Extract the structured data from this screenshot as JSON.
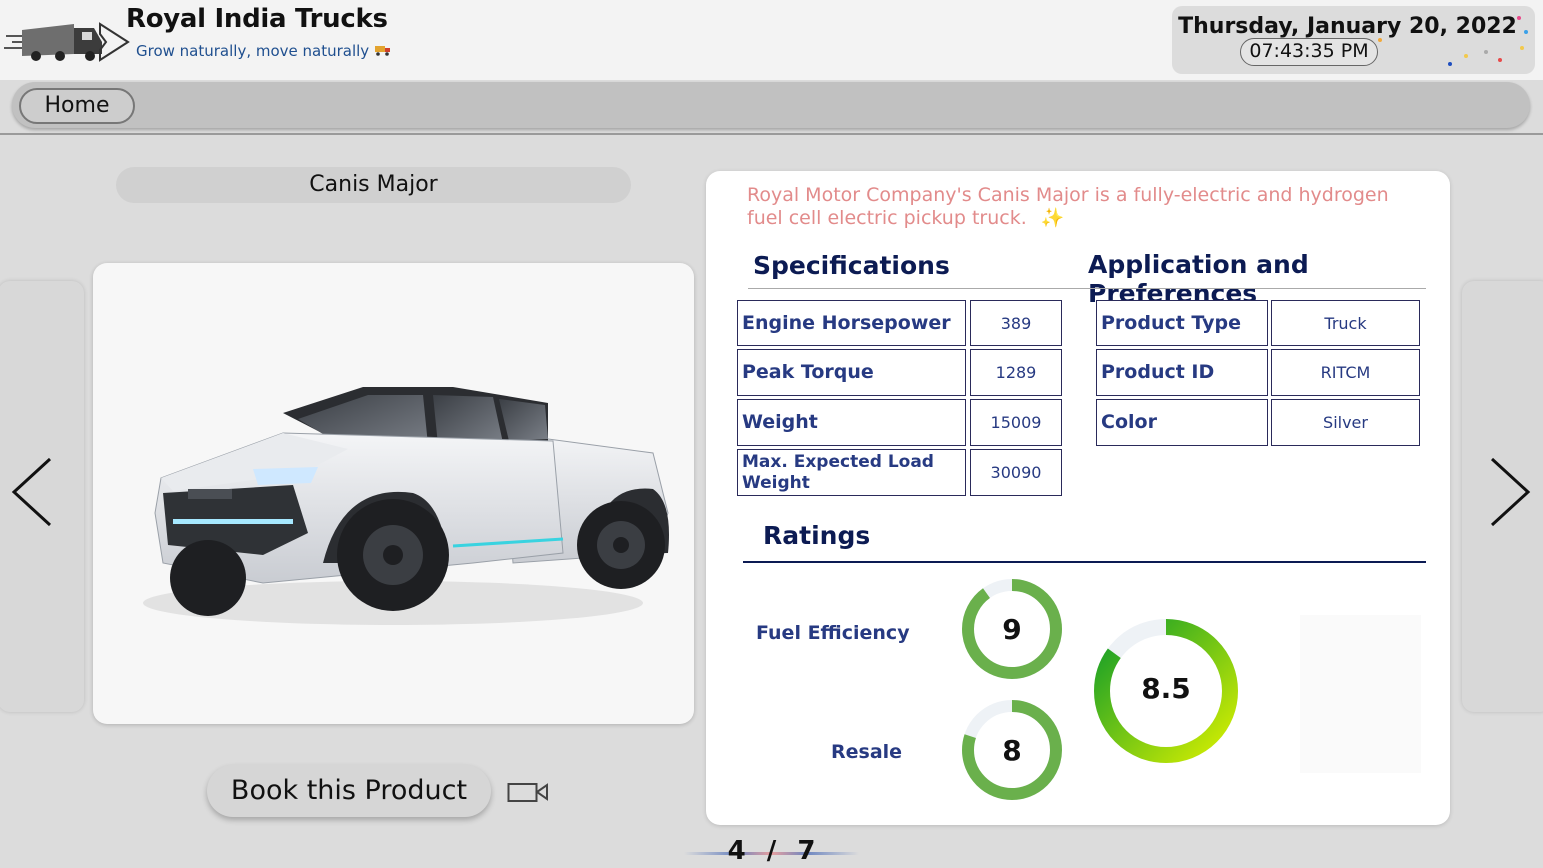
{
  "header": {
    "title": "Royal India Trucks",
    "tagline": "Grow naturally, move naturally",
    "tagline_icon": "truck-emoji",
    "date": "Thursday, January 20, 2022",
    "time": "07:43:35 PM"
  },
  "nav": {
    "home_label": "Home"
  },
  "product": {
    "name": "Canis Major",
    "description": "Royal Motor Company's Canis Major is a fully-electric and hydrogen fuel cell electric pickup truck.",
    "description_icon": "sparkles",
    "book_label": "Book this Product",
    "video_icon": "video-camera-icon"
  },
  "specifications": {
    "heading": "Specifications",
    "rows": [
      {
        "label": "Engine Horsepower",
        "value": "389"
      },
      {
        "label": "Peak Torque",
        "value": "1289"
      },
      {
        "label": "Weight",
        "value": "15009"
      },
      {
        "label": "Max. Expected Load Weight",
        "value": "30090"
      }
    ]
  },
  "application": {
    "heading": "Application and Preferences",
    "rows": [
      {
        "label": "Product Type",
        "value": "Truck"
      },
      {
        "label": "Product ID",
        "value": "RITCM"
      },
      {
        "label": "Color",
        "value": "Silver"
      }
    ]
  },
  "ratings": {
    "heading": "Ratings",
    "fuel_efficiency": {
      "label": "Fuel Efficiency",
      "value": "9",
      "fraction": 0.9
    },
    "resale": {
      "label": "Resale",
      "value": "8",
      "fraction": 0.8
    },
    "overall": {
      "value": "8.5",
      "fraction": 0.85
    },
    "colors": {
      "gauge_green": "#6ab04c",
      "overall_start": "#d8f000",
      "overall_end": "#0f9b2a"
    }
  },
  "pager": {
    "current": "4",
    "separator": "/",
    "total": "7"
  },
  "colors": {
    "description": "#e28b8b",
    "heading": "#0c1b53",
    "cell_text": "#273a82",
    "tagline": "#1f4f8f"
  }
}
